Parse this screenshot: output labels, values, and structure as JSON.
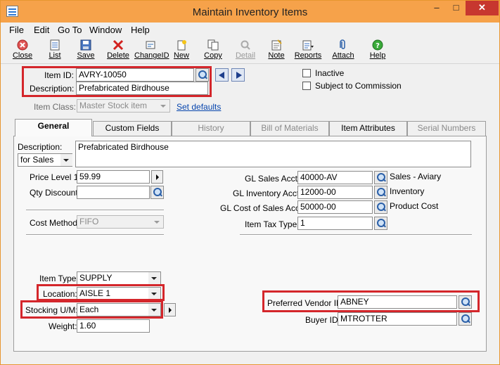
{
  "window": {
    "title": "Maintain Inventory Items"
  },
  "menu": [
    "File",
    "Edit",
    "Go To",
    "Window",
    "Help"
  ],
  "toolbar": [
    {
      "label": "Close",
      "icon": "close-icon"
    },
    {
      "label": "List",
      "icon": "list-icon"
    },
    {
      "label": "Save",
      "icon": "save-icon"
    },
    {
      "label": "Delete",
      "icon": "delete-icon"
    },
    {
      "label": "ChangeID",
      "icon": "change-id-icon"
    },
    {
      "label": "New",
      "icon": "new-icon"
    },
    {
      "label": "Copy",
      "icon": "copy-icon"
    },
    {
      "label": "Detail",
      "icon": "detail-icon"
    },
    {
      "label": "Note",
      "icon": "note-icon"
    },
    {
      "label": "Reports",
      "icon": "reports-icon"
    },
    {
      "label": "Attach",
      "icon": "attach-icon"
    },
    {
      "label": "Help",
      "icon": "help-icon"
    }
  ],
  "header": {
    "item_id_label": "Item ID:",
    "item_id": "AVRY-10050",
    "description_label": "Description:",
    "description": "Prefabricated Birdhouse",
    "item_class_label": "Item Class:",
    "item_class": "Master Stock item",
    "set_defaults": "Set defaults",
    "inactive_label": "Inactive",
    "inactive_checked": false,
    "commission_label": "Subject to Commission",
    "commission_checked": false
  },
  "tabs": [
    {
      "label": "General",
      "active": true,
      "disabled": false
    },
    {
      "label": "Custom Fields",
      "active": false,
      "disabled": false
    },
    {
      "label": "History",
      "active": false,
      "disabled": true
    },
    {
      "label": "Bill of Materials",
      "active": false,
      "disabled": true
    },
    {
      "label": "Item Attributes",
      "active": false,
      "disabled": false
    },
    {
      "label": "Serial Numbers",
      "active": false,
      "disabled": true
    }
  ],
  "general": {
    "description_label": "Description:",
    "description_type": "for Sales",
    "description_text": "Prefabricated Birdhouse",
    "price_level_label": "Price Level 1:",
    "price_level": "59.99",
    "qty_discount_label": "Qty Discount:",
    "qty_discount": "",
    "cost_method_label": "Cost Method:",
    "cost_method": "FIFO",
    "gl_sales_label": "GL Sales Acct:",
    "gl_sales": "40000-AV",
    "gl_sales_desc": "Sales - Aviary",
    "gl_inventory_label": "GL Inventory Acct:",
    "gl_inventory": "12000-00",
    "gl_inventory_desc": "Inventory",
    "gl_cost_label": "GL Cost of Sales Acct:",
    "gl_cost": "50000-00",
    "gl_cost_desc": "Product Cost",
    "tax_type_label": "Item Tax Type:",
    "tax_type": "1",
    "item_type_label": "Item Type:",
    "item_type": "SUPPLY",
    "location_label": "Location:",
    "location": "AISLE 1",
    "stocking_um_label": "Stocking U/M:",
    "stocking_um": "Each",
    "weight_label": "Weight:",
    "weight": "1.60",
    "vendor_label": "Preferred Vendor ID:",
    "vendor": "ABNEY",
    "buyer_label": "Buyer ID:",
    "buyer": "MTROTTER"
  },
  "colors": {
    "title_bar": "#f6a24a",
    "highlight": "#d4262b",
    "close_button": "#c7372f"
  }
}
